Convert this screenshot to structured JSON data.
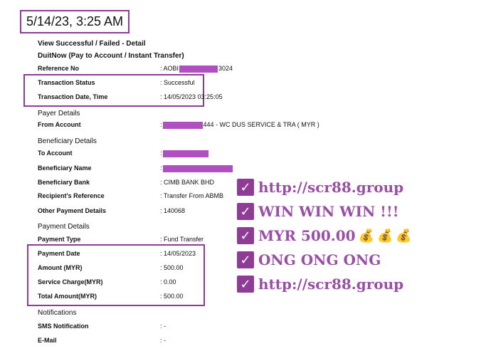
{
  "screenshot_caption": {
    "datetime": "5/14/23, 3:25 AM"
  },
  "page": {
    "title": "View Successful / Failed - Detail",
    "subtitle": "DuitNow (Pay to Account / Instant Transfer)"
  },
  "fields": [
    {
      "id": "reference_no",
      "label": "Reference No",
      "value_prefix": ": AOBI",
      "value_suffix": "3024"
    },
    {
      "id": "transaction_status",
      "label": "Transaction Status",
      "value": ": Successful"
    },
    {
      "id": "transaction_datetime",
      "label": "Transaction Date, Time",
      "value": ": 14/05/2023 03:25:05"
    }
  ],
  "sections": {
    "payer_details": "Payer Details",
    "beneficiary_details": "Beneficiary Details",
    "payment_details": "Payment Details",
    "notifications": "Notifications"
  },
  "payer": {
    "from_account_label": "From Account",
    "from_account_value_prefix": ":",
    "from_account_value_suffix": "444 - WC DUS SERVICE & TRA ( MYR )"
  },
  "beneficiary": {
    "to_account_label": "To Account",
    "to_account_value_prefix": ":",
    "beneficiary_name_label": "Beneficiary Name",
    "beneficiary_name_value_prefix": ":",
    "beneficiary_bank_label": "Beneficiary Bank",
    "beneficiary_bank_value": ": CIMB BANK BHD",
    "recipient_reference_label": "Recipient's Reference",
    "recipient_reference_value": ": Transfer From ABMB",
    "other_payment_details_label": "Other Payment Details",
    "other_payment_details_value": ": 140068"
  },
  "payment": {
    "payment_type_label": "Payment Type",
    "payment_type_value": ": Fund Transfer",
    "payment_date_label": "Payment Date",
    "payment_date_value": ": 14/05/2023",
    "amount_label": "Amount (MYR)",
    "amount_value": ": 500.00",
    "service_charge_label": "Service Charge(MYR)",
    "service_charge_value": ": 0.00",
    "total_amount_label": "Total Amount(MYR)",
    "total_amount_value": ": 500.00"
  },
  "notifications": {
    "sms_label": "SMS Notification",
    "sms_value": ": -",
    "email_label": "E-Mail",
    "email_value": ": -"
  },
  "promo": {
    "items": [
      {
        "text": "http://scr88.group"
      },
      {
        "text": "WIN WIN WIN !!!"
      },
      {
        "text": "MYR 500.00",
        "money_bags": 3
      },
      {
        "text": "ONG ONG ONG"
      },
      {
        "text": "http://scr88.group"
      }
    ],
    "check_icon": "check-icon",
    "money_bag_icon": "money-bag-icon",
    "color": "#8e3c95"
  }
}
